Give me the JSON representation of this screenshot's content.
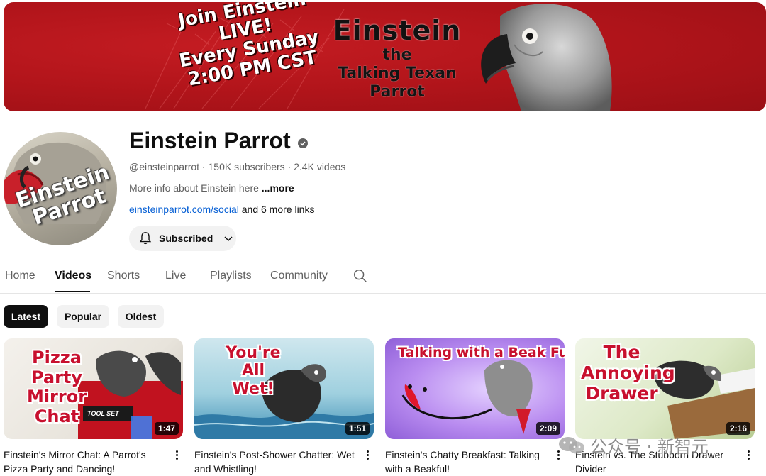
{
  "banner": {
    "left_lines": [
      "Join Einstein",
      "LIVE!",
      "Every Sunday",
      "2:00 PM CST"
    ],
    "title_big": "Einstein",
    "title_small": [
      "the",
      "Talking Texan",
      "Parrot"
    ],
    "colors": {
      "background": "#b3151b",
      "text_light": "#ffffff",
      "text_dark": "#111111"
    }
  },
  "channel": {
    "avatar_text": [
      "Einstein",
      "Parrot"
    ],
    "name": "Einstein Parrot",
    "verified_icon": "check-circle-icon",
    "handle": "@einsteinparrot",
    "subscribers": "150K subscribers",
    "videos": "2.4K videos",
    "separator": " · ",
    "about": "More info about Einstein here ",
    "about_more": "...more",
    "link": "einsteinparrot.com/social",
    "link_more": " and 6 more links",
    "subscribe_label": "Subscribed"
  },
  "tabs": [
    {
      "label": "Home"
    },
    {
      "label": "Videos"
    },
    {
      "label": "Shorts"
    },
    {
      "label": "Live"
    },
    {
      "label": "Playlists"
    },
    {
      "label": "Community"
    }
  ],
  "active_tab": "Videos",
  "filters": [
    {
      "label": "Latest"
    },
    {
      "label": "Popular"
    },
    {
      "label": "Oldest"
    }
  ],
  "active_filter": "Latest",
  "videos": [
    {
      "thumb_text": [
        "Pizza Party",
        "Mirror",
        "Chat"
      ],
      "thumb_badge": "TOOL SET",
      "duration": "1:47",
      "title": "Einstein's Mirror Chat: A Parrot's Pizza Party and Dancing!"
    },
    {
      "thumb_text": [
        "You're All",
        "Wet!"
      ],
      "duration": "1:51",
      "title": "Einstein's Post-Shower Chatter: Wet and Whistling!"
    },
    {
      "thumb_text": [
        "Talking with a Beak Full!"
      ],
      "duration": "2:09",
      "title": "Einstein's Chatty Breakfast: Talking with a Beakful!"
    },
    {
      "thumb_text": [
        "The",
        "Annoying",
        "Drawer"
      ],
      "duration": "2:16",
      "title": "Einstein vs. The Stubborn Drawer Divider"
    }
  ],
  "watermark": "公众号 · 新智元"
}
